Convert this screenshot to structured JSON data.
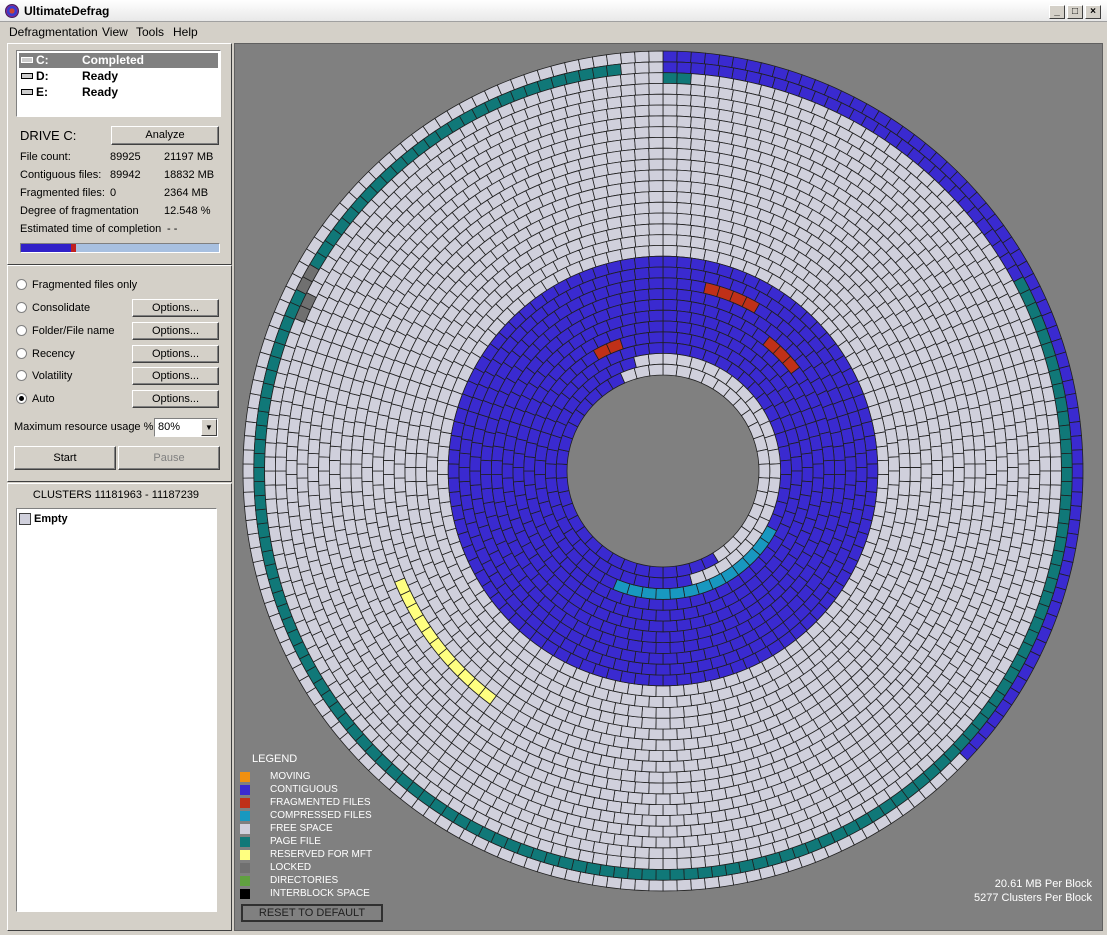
{
  "window": {
    "title": "UltimateDefrag",
    "minimize": "_",
    "maximize": "□",
    "close": "×"
  },
  "menu": [
    "Defragmentation",
    "View",
    "Tools",
    "Help"
  ],
  "drives": [
    {
      "letter": "C:",
      "status": "Completed"
    },
    {
      "letter": "D:",
      "status": "Ready"
    },
    {
      "letter": "E:",
      "status": "Ready"
    }
  ],
  "drive_info": {
    "heading": "DRIVE C:",
    "analyze_label": "Analyze",
    "rows": [
      {
        "label": "File count:",
        "v1": "89925",
        "v2": "21197 MB"
      },
      {
        "label": "Contiguous files:",
        "v1": "89942",
        "v2": "18832 MB"
      },
      {
        "label": "Fragmented files:",
        "v1": "0",
        "v2": "2364 MB"
      },
      {
        "label": "Degree of fragmentation",
        "v1": "",
        "v2": "12.548 %"
      }
    ],
    "eta_label": "Estimated time of completion",
    "eta_value": "- -",
    "progress": {
      "contiguous": 0.25,
      "fragmented": 0.025
    }
  },
  "modes": [
    {
      "label": "Fragmented files only",
      "has_options": false,
      "selected": false
    },
    {
      "label": "Consolidate",
      "has_options": true,
      "selected": false
    },
    {
      "label": "Folder/File name",
      "has_options": true,
      "selected": false
    },
    {
      "label": "Recency",
      "has_options": true,
      "selected": false
    },
    {
      "label": "Volatility",
      "has_options": true,
      "selected": false
    },
    {
      "label": "Auto",
      "has_options": true,
      "selected": true
    }
  ],
  "options_label": "Options...",
  "resource": {
    "label": "Maximum resource usage %",
    "value": "80%"
  },
  "start_label": "Start",
  "pause_label": "Pause",
  "clusters": {
    "heading": "CLUSTERS 11181963 - 11187239",
    "items": [
      {
        "label": "Empty"
      }
    ]
  },
  "legend": {
    "title": "LEGEND",
    "items": [
      {
        "label": "MOVING",
        "color": "#f09010"
      },
      {
        "label": "CONTIGUOUS",
        "color": "#3a2ad0"
      },
      {
        "label": "FRAGMENTED FILES",
        "color": "#c03018"
      },
      {
        "label": "COMPRESSED FILES",
        "color": "#1898c0"
      },
      {
        "label": "FREE SPACE",
        "color": "#d0d0dc"
      },
      {
        "label": "PAGE FILE",
        "color": "#107878"
      },
      {
        "label": "RESERVED FOR MFT",
        "color": "#ffff80"
      },
      {
        "label": "LOCKED",
        "color": "#707070"
      },
      {
        "label": "DIRECTORIES",
        "color": "#60a040"
      },
      {
        "label": "INTERBLOCK SPACE",
        "color": "#000000"
      }
    ],
    "reset_label": "RESET TO DEFAULT"
  },
  "block_info": {
    "per_block": "20.61 MB Per Block",
    "clusters_per_block": "5277 Clusters Per Block"
  }
}
